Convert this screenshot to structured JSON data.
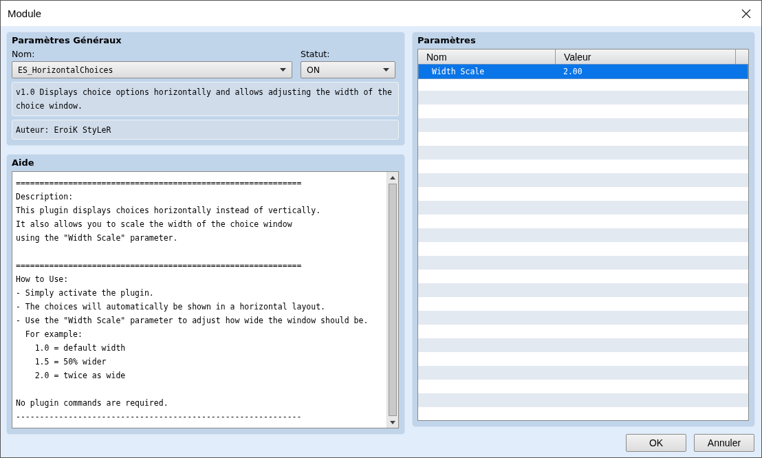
{
  "window": {
    "title": "Module"
  },
  "general": {
    "title": "Paramètres Généraux",
    "name_label": "Nom:",
    "name_value": "ES_HorizontalChoices",
    "status_label": "Statut:",
    "status_value": "ON",
    "description": "v1.0 Displays choice options horizontally and allows adjusting the width of the choice window.",
    "author": "Auteur: EroiK StyLeR"
  },
  "help": {
    "title": "Aide",
    "paragraphs": [
      [
        "============================================================",
        "Description:",
        "This plugin displays choices horizontally instead of vertically.",
        "It also allows you to scale the width of the choice window",
        "using the \"Width Scale\" parameter."
      ],
      [
        "============================================================",
        "How to Use:",
        "- Simply activate the plugin.",
        "- The choices will automatically be shown in a horizontal layout.",
        "- Use the \"Width Scale\" parameter to adjust how wide the window should be.",
        "  For example:",
        "    1.0 = default width",
        "    1.5 = 50% wider",
        "    2.0 = twice as wide"
      ],
      [
        "No plugin commands are required.",
        "------------------------------------------------------------"
      ]
    ]
  },
  "parameters": {
    "title": "Paramètres",
    "columns": [
      "Nom",
      "Valeur"
    ],
    "rows": [
      {
        "name": "Width Scale",
        "value": "2.00",
        "selected": true
      }
    ]
  },
  "buttons": [
    "OK",
    "Annuler"
  ]
}
